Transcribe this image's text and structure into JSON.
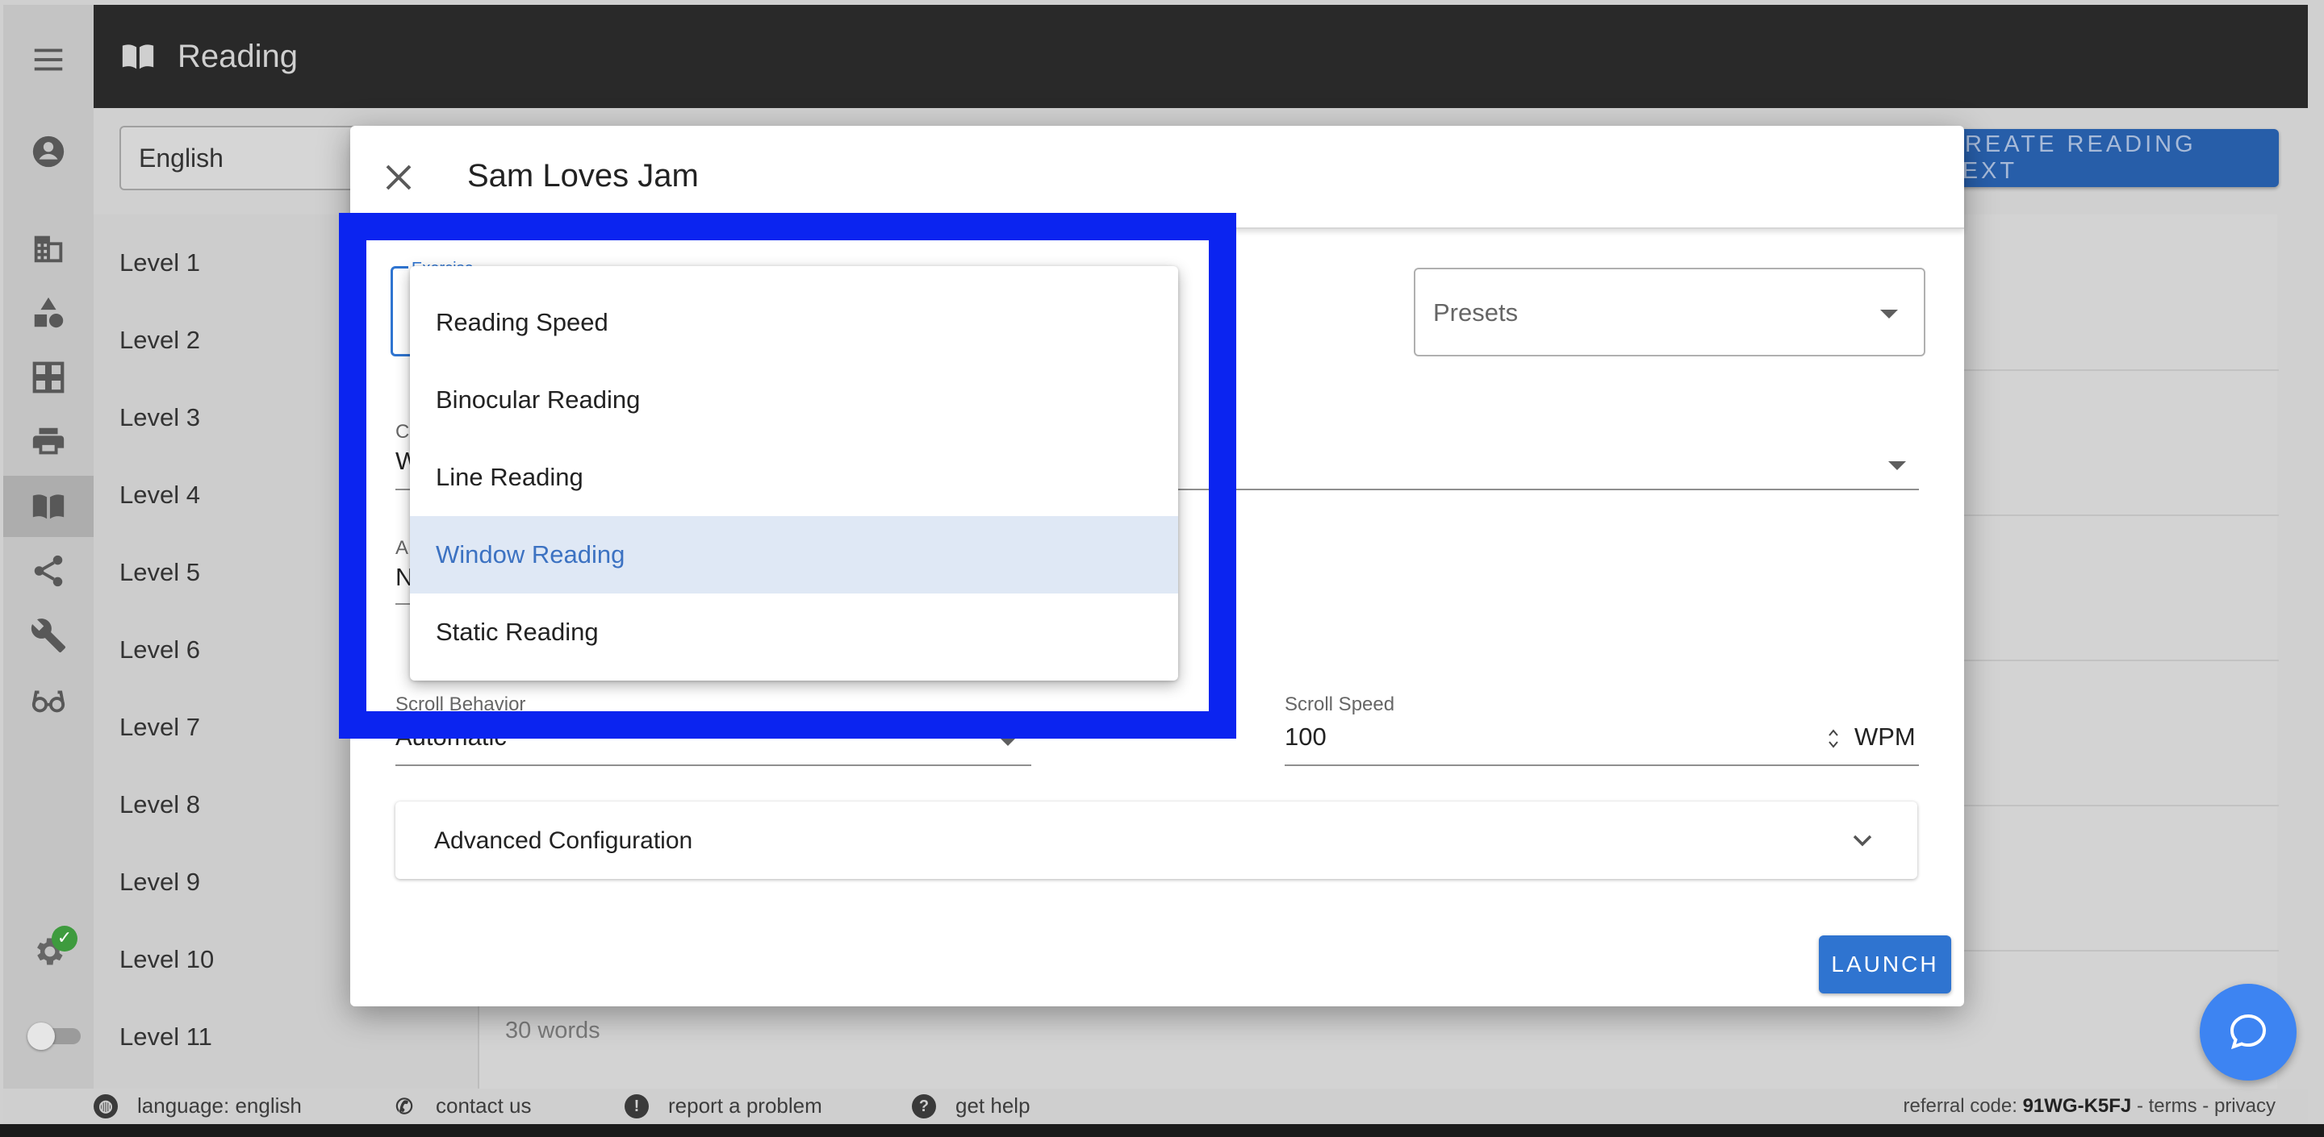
{
  "app": {
    "title": "Reading",
    "language_select": "English",
    "create_button": "CREATE READING TEXT"
  },
  "levels": [
    "Level 1",
    "Level 2",
    "Level 3",
    "Level 4",
    "Level 5",
    "Level 6",
    "Level 7",
    "Level 8",
    "Level 9",
    "Level 10",
    "Level 11"
  ],
  "content": {
    "word_count": "30 words"
  },
  "sidebar": {
    "icons": [
      "menu-icon",
      "account-icon",
      "office-icon",
      "shapes-icon",
      "grid-icon",
      "printer-icon",
      "reading-icon",
      "share-icon",
      "wrench-icon",
      "glasses-icon"
    ],
    "active": "reading-icon"
  },
  "dialog": {
    "title": "Sam Loves Jam",
    "exercise_label": "Exercise",
    "presets_placeholder": "Presets",
    "partial_field_1_label": "C",
    "partial_field_1_value": "W",
    "partial_field_2_label": "A",
    "partial_field_2_value": "N",
    "scroll_behavior_label": "Scroll Behavior",
    "scroll_behavior_value": "Automatic",
    "scroll_speed_label": "Scroll Speed",
    "scroll_speed_value": "100",
    "scroll_speed_unit": "WPM",
    "advanced_label": "Advanced Configuration",
    "launch_label": "LAUNCH"
  },
  "exercise_menu": {
    "options": [
      "Reading Speed",
      "Binocular Reading",
      "Line Reading",
      "Window Reading",
      "Static Reading"
    ],
    "selected": "Window Reading"
  },
  "footer": {
    "language": "language: english",
    "contact": "contact us",
    "report": "report a problem",
    "help": "get help",
    "referral_prefix": "referral code:",
    "referral_code": "91WG-K5FJ",
    "sep": "-",
    "terms": "terms",
    "privacy": "privacy"
  },
  "colors": {
    "highlight": "#0b24f0",
    "accent": "#2f74d0",
    "selected_bg": "#dfe8f5",
    "topbar": "#292929",
    "chat_fab": "#3d84f2"
  }
}
